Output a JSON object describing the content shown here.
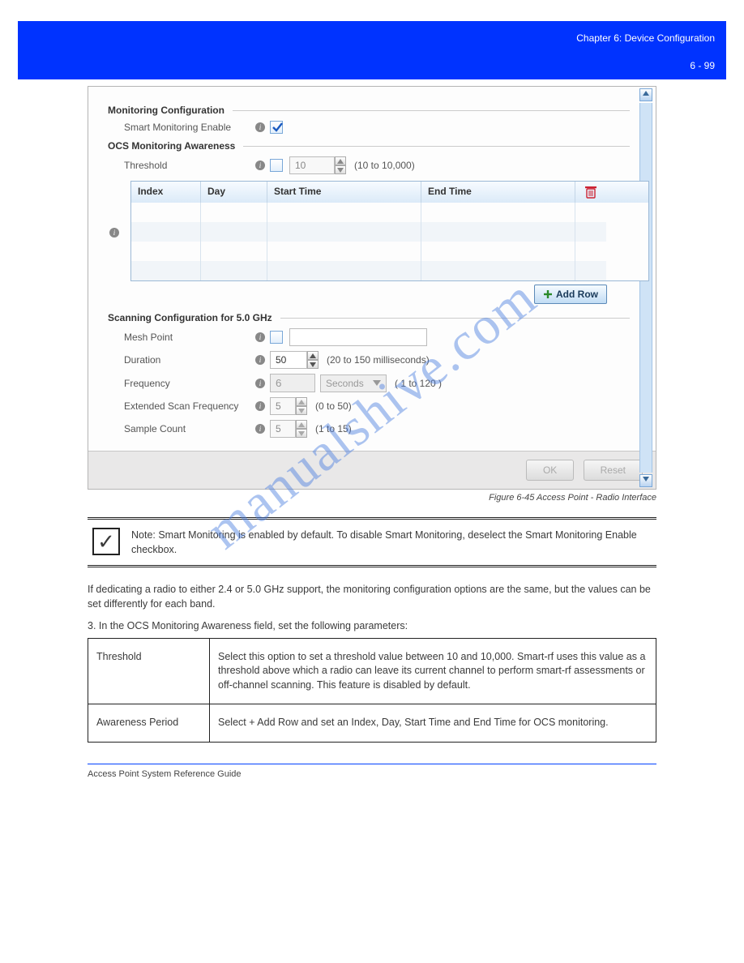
{
  "header": {
    "chapter": "Chapter 6: Device Configuration",
    "page": "6 - 99"
  },
  "screenshot": {
    "monitoring": {
      "title": "Monitoring Configuration",
      "smart_enable_label": "Smart Monitoring Enable",
      "smart_enable_checked": true
    },
    "ocs": {
      "title": "OCS Monitoring Awareness",
      "threshold_label": "Threshold",
      "threshold_value": "10",
      "threshold_hint": "(10 to 10,000)"
    },
    "table": {
      "cols": {
        "index": "Index",
        "day": "Day",
        "start": "Start Time",
        "end": "End Time"
      },
      "add_row": "Add Row"
    },
    "scan": {
      "title": "Scanning Configuration for 5.0 GHz",
      "mesh_label": "Mesh Point",
      "duration_label": "Duration",
      "duration_value": "50",
      "duration_hint": "(20 to 150 milliseconds)",
      "freq_label": "Frequency",
      "freq_value": "6",
      "freq_unit": "Seconds",
      "freq_hint": "( 1 to 120 )",
      "ext_label": "Extended Scan Frequency",
      "ext_value": "5",
      "ext_hint": "(0 to 50)",
      "sample_label": "Sample Count",
      "sample_value": "5",
      "sample_hint": "(1 to 15)"
    },
    "buttons": {
      "ok": "OK",
      "reset": "Reset"
    }
  },
  "figure_label": "Figure 6-45 Access Point - Radio Interface",
  "note": {
    "text": "Note: Smart Monitoring is enabled by default. To disable Smart Monitoring, deselect the Smart Monitoring Enable checkbox."
  },
  "para1": "If dedicating a radio to either 2.4 or 5.0 GHz support, the monitoring configuration options are the same, but the values can be set differently for each band.",
  "step": "3. In the OCS Monitoring Awareness field, set the following parameters:",
  "params": {
    "threshold": {
      "name": "Threshold",
      "desc": "Select this option to set a threshold value between 10 and 10,000. Smart-rf uses this value as a threshold above which a radio can leave its current channel to perform smart-rf assessments or off-channel scanning. This feature is disabled by default."
    },
    "period": {
      "name": "Awareness Period",
      "desc": "Select + Add Row and set an Index, Day, Start Time and End Time for OCS monitoring."
    }
  },
  "footer": {
    "left": "Access Point System Reference Guide",
    "right": ""
  },
  "watermark": "manualshive.com"
}
